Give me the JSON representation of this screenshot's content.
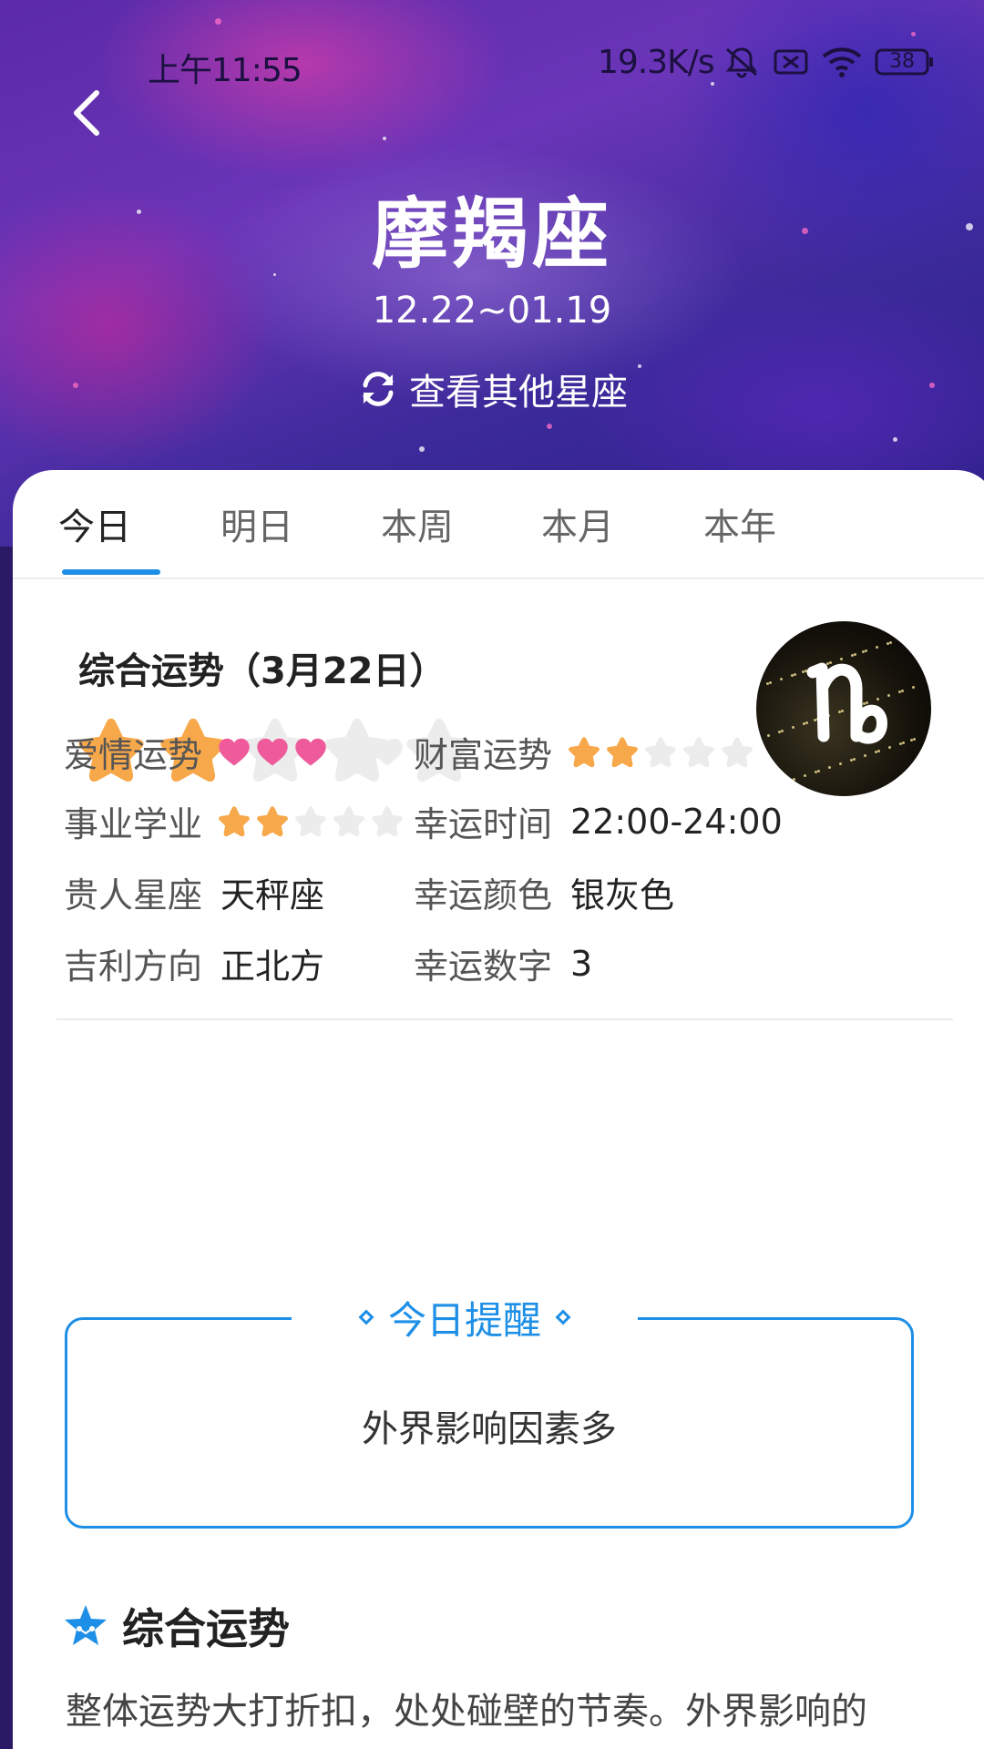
{
  "status_bar": {
    "time": "上午11:55",
    "network_speed": "19.3K/s",
    "battery": "38",
    "icons": [
      "mute-icon",
      "sim-off-icon",
      "wifi-icon",
      "battery-icon"
    ]
  },
  "header": {
    "back_icon": "chevron-left-icon",
    "sign_name": "摩羯座",
    "date_range": "12.22~01.19",
    "switch_label": "查看其他星座",
    "switch_icon": "refresh-icon"
  },
  "tabs": [
    {
      "label": "今日",
      "active": true
    },
    {
      "label": "明日",
      "active": false
    },
    {
      "label": "本周",
      "active": false
    },
    {
      "label": "本月",
      "active": false
    },
    {
      "label": "本年",
      "active": false
    }
  ],
  "overall": {
    "title": "综合运势（3月22日）",
    "rating": 2,
    "max_rating": 5,
    "avatar_icon": "capricorn-symbol-icon"
  },
  "details": {
    "love": {
      "label": "爱情运势",
      "rating": 3,
      "max": 5
    },
    "wealth": {
      "label": "财富运势",
      "rating": 2,
      "max": 5
    },
    "career": {
      "label": "事业学业",
      "rating": 2,
      "max": 5
    },
    "lucky_time": {
      "label": "幸运时间",
      "value": "22:00-24:00"
    },
    "noble_sign": {
      "label": "贵人星座",
      "value": "天秤座"
    },
    "lucky_color": {
      "label": "幸运颜色",
      "value": "银灰色"
    },
    "direction": {
      "label": "吉利方向",
      "value": "正北方"
    },
    "lucky_number": {
      "label": "幸运数字",
      "value": "3"
    }
  },
  "reminder": {
    "heading": "今日提醒",
    "text": "外界影响因素多"
  },
  "summary": {
    "heading": "综合运势",
    "icon": "star-badge-icon",
    "text": "整体运势大打折扣，处处碰壁的节奏。外界影响的"
  },
  "colors": {
    "accent": "#1e8fe6",
    "star_on": "#f7a84a",
    "heart_on": "#ee5a9a",
    "rating_off": "#ececec"
  }
}
